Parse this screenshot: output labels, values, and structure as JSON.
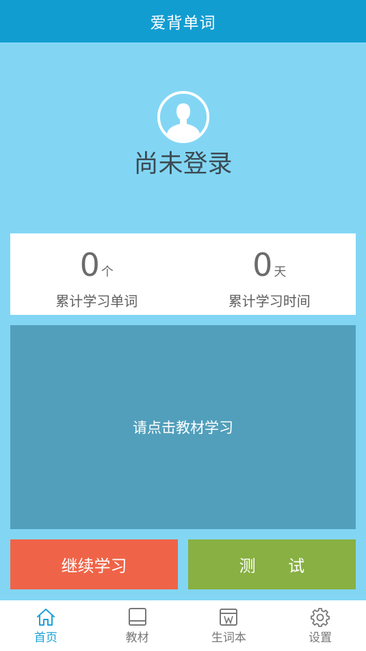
{
  "header": {
    "title": "爱背单词"
  },
  "profile": {
    "login_status": "尚未登录",
    "avatar_icon": "user-avatar-icon"
  },
  "stats": [
    {
      "value": "0",
      "unit": "个",
      "label": "累计学习单词"
    },
    {
      "value": "0",
      "unit": "天",
      "label": "累计学习时间"
    }
  ],
  "study_panel": {
    "text": "请点击教材学习"
  },
  "buttons": {
    "continue": "继续学习",
    "test": "测 试"
  },
  "tabbar": [
    {
      "label": "首页",
      "icon": "home-icon",
      "active": true
    },
    {
      "label": "教材",
      "icon": "book-icon",
      "active": false
    },
    {
      "label": "生词本",
      "icon": "vocabulary-notebook-icon",
      "active": false
    },
    {
      "label": "设置",
      "icon": "gear-icon",
      "active": false
    }
  ],
  "colors": {
    "header": "#129dd1",
    "background": "#82d6f4",
    "study_panel": "#529fbb",
    "continue_button": "#ef6448",
    "test_button": "#88b043",
    "tab_active": "#1aa1d8"
  }
}
